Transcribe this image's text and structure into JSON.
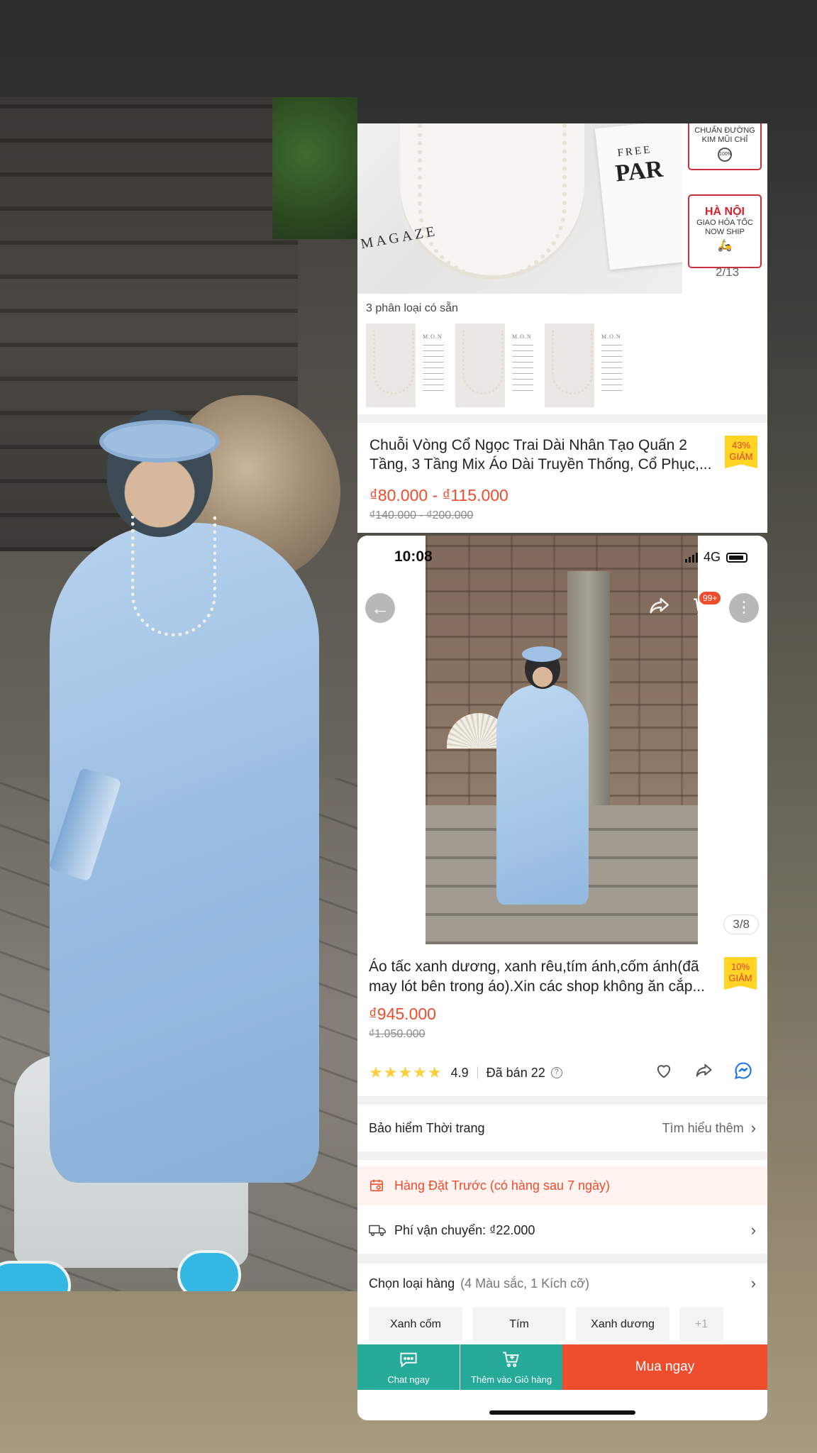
{
  "top_listing": {
    "image_card": {
      "small": "FREE",
      "big": "PAR",
      "magazine": "MAGAZE"
    },
    "badges": {
      "badge1_line1": "CHUẨN ĐƯỜNG",
      "badge1_line2": "KIM MŨI CHỈ",
      "badge1_mark": "100%",
      "badge2_title": "HÀ NỘI",
      "badge2_line1": "GIAO HỎA TỐC",
      "badge2_line2": "NOW SHIP"
    },
    "image_counter": "2/13",
    "variant_count_text": "3 phân loại có sẵn",
    "thumb_label": "M.O.N",
    "title": "Chuỗi Vòng Cổ Ngọc Trai Dài Nhân Tạo Quấn 2 Tầng, 3 Tầng Mix Áo Dài Truyền Thống, Cổ Phục,...",
    "discount_pct": "43%",
    "discount_word": "GIẢM",
    "price": "₫80.000 - ₫115.000",
    "old_price": "₫140.000 - ₫200.000"
  },
  "phone": {
    "status": {
      "time": "10:08",
      "network": "4G"
    },
    "cart_badge": "99+",
    "image_counter": "3/8",
    "title": "Áo tấc xanh dương, xanh rêu,tím ánh,cốm ánh(đã may lót bên trong áo).Xin các shop không ăn cắp...",
    "discount_pct": "10%",
    "discount_word": "GIẢM",
    "price": "₫945.000",
    "old_price": "₫1.050.000",
    "rating": {
      "stars": "★★★★★",
      "value": "4.9",
      "sold": "Đã bán 22"
    },
    "insurance": {
      "label": "Bảo hiểm Thời trang",
      "link": "Tìm hiểu thêm"
    },
    "preorder": "Hàng Đặt Trước (có hàng sau 7 ngày)",
    "shipping": "Phí vận chuyển: ₫22.000",
    "variant": {
      "title": "Chọn loại hàng",
      "summary": "(4 Màu sắc, 1 Kích cỡ)",
      "options": [
        "Xanh cốm",
        "Tím",
        "Xanh dương",
        "+1"
      ]
    },
    "bottom": {
      "chat": "Chat ngay",
      "add_cart": "Thêm vào Giỏ hàng",
      "buy": "Mua ngay"
    }
  },
  "colors": {
    "accent": "#ee4d2d",
    "teal": "#26aa99",
    "star": "#ffce3d",
    "badge": "#ffd424"
  }
}
